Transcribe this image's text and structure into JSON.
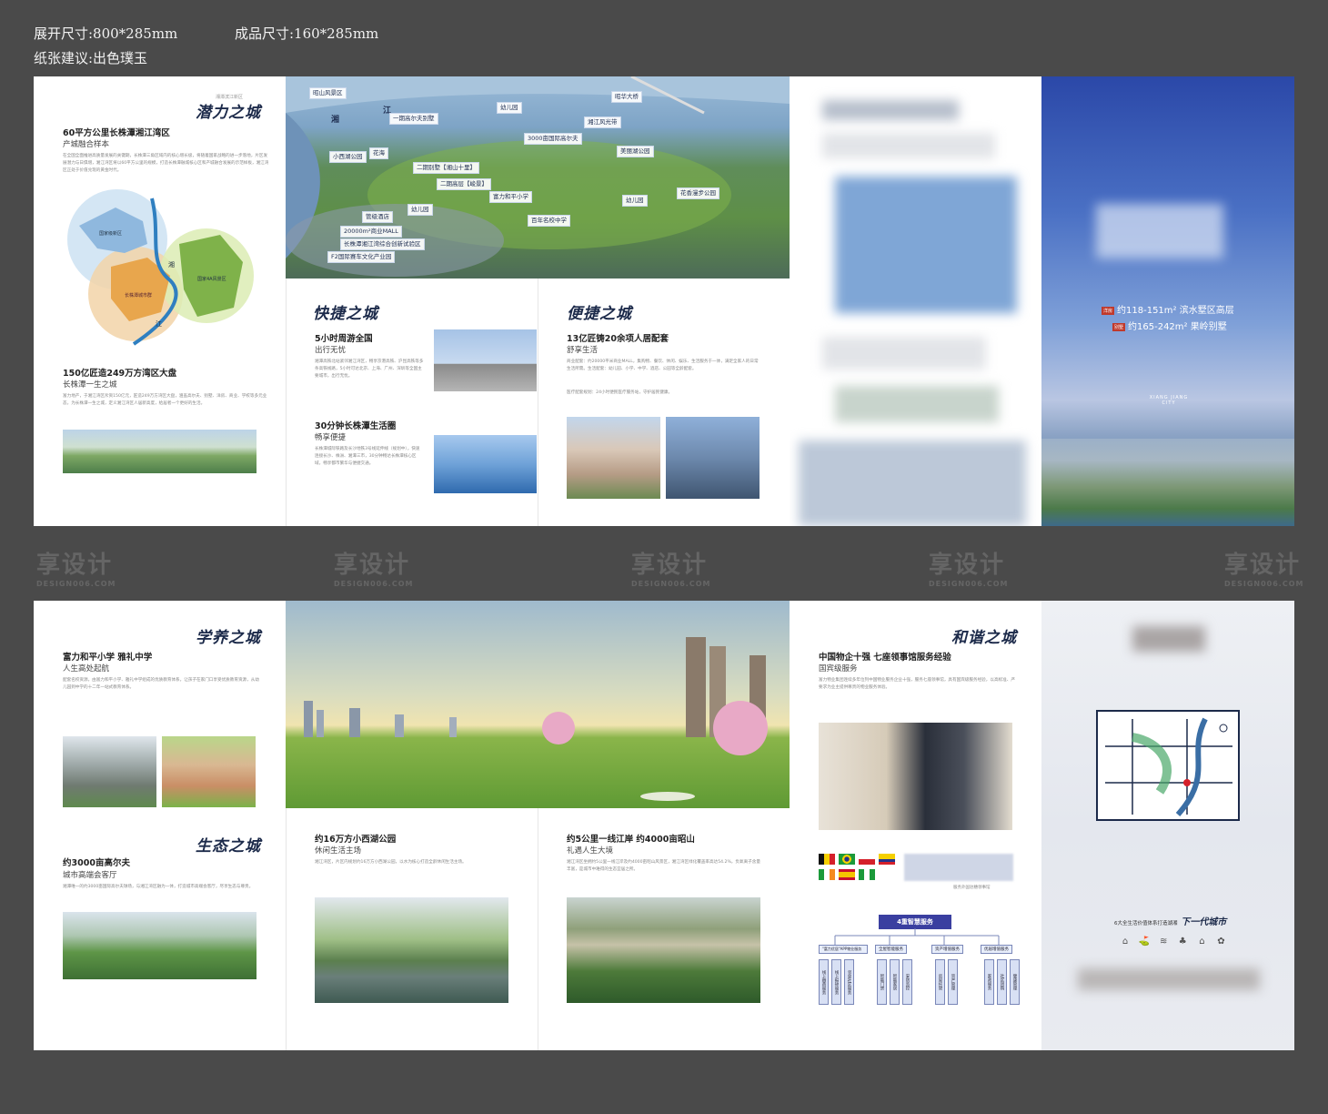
{
  "specs": {
    "expanded_size": "展开尺寸:800*285mm",
    "finished_size": "成品尺寸:160*285mm",
    "paper": "纸张建议:出色璞玉"
  },
  "watermark": {
    "text": "享设计",
    "sub": "DESIGN006.COM"
  },
  "top": {
    "p1": {
      "brand": "潜力之城",
      "brand_sup": "湘潭滨江新区",
      "title1": "60平方公里长株潭湘江湾区",
      "sub1": "产城融合样本",
      "body1": "在全国全面推进高质量发展的关键期，长株潭三角区域内的核心增长极，将随着国家战略的进一步落地，片区发展潜力与日俱增，湘江湾区将以60平方公里的规模，打造长株潭融城核心区和产城融合发展的示范样板，湘江湾区正处于价值兑现的黄金时代。",
      "map_labels": {
        "l1": "国家级新区",
        "l2": "湘",
        "l3": "长株潭城市群",
        "l4": "国家4A风景区",
        "l5": "江"
      },
      "title2": "150亿匠造249万方湾区大盘",
      "sub2": "长株潭一生之城",
      "body2": "富力地产，于湘江湾区斥资150亿元，匠造249万方湾区大盘，涵盖高尔夫、别墅、洋房、商业、学校等多元业态，为长株潭一生之城，定义湘江湾区人居新高度，给居者一个更好的生活。"
    },
    "aerial": {
      "labels": [
        "昭山风景区",
        "湘",
        "江",
        "一期高尔夫别墅",
        "幼儿园",
        "湘江风光带",
        "3000亩国际高尔夫",
        "花海",
        "小西湖公园",
        "二期别墅【湘山十里】",
        "美丽湖公园",
        "二期高层【峻景】",
        "富力和平小学",
        "幼儿园",
        "幼儿园",
        "花香漫步公园",
        "管级酒店",
        "百年名校中学",
        "20000m²商业MALL",
        "长株潭湘江湾综合创新试验区",
        "F2国际赛车文化产业园"
      ],
      "bridge": "昭华大桥"
    },
    "p2a": {
      "brand": "快捷之城",
      "title1": "5小时周游全国",
      "sub1": "出行无忧",
      "body1": "湘潭高铁北站紧邻湘江湾区，畅享京港高铁、沪昆高铁等多条高铁线路，5小时可达北京、上海、广州、深圳等全国主要城市，出行无忧。",
      "title2": "30分钟长株潭生活圈",
      "sub2": "畅享便捷",
      "body2": "长株潭城际铁路及长沙地铁3号线延伸线（规划中），快速连接长沙、株洲、湘潭三市，30分钟畅达长株潭核心区域，畅享都市繁华与便捷交通。"
    },
    "p2b": {
      "brand": "便捷之城",
      "title1": "13亿匠铸20余项人居配套",
      "sub1": "舒享生活",
      "body1": "商业配套：约20000平米商业MALL，集购物、餐饮、休闲、娱乐、生活服务于一体，满足全家人的日常生活所需。生活配套：幼儿园、小学、中学、酒店、公园等全龄配套。",
      "body2": "医疗配套规划：24小时便民医疗服务站，守护居民健康。"
    },
    "cover": {
      "line1_badge": "洋房",
      "line1": "约118-151m² 滨水墅区高层",
      "line2_badge": "别墅",
      "line2": "约165-242m² 果岭别墅",
      "logo": "XIANG JIANG CITY"
    }
  },
  "bottom": {
    "p1": {
      "brand": "学养之城",
      "title1": "富力和平小学 雅礼中学",
      "sub1": "人生高处起航",
      "body1": "配套名校资源，由富力和平小学、雅礼中学组成的优质教育体系，让孩子在家门口享受优质教育资源，从幼儿园到中学的十二年一站式教育体系。",
      "brand2": "生态之城",
      "title2": "约3000亩高尔夫",
      "sub2": "城市高端会客厅",
      "body2": "湘潭唯一的约3000亩国际高尔夫球场，与湘江湾区融为一体，打造城市高端会客厅，尽享生态与尊贵。"
    },
    "p2": {
      "title1": "约16万方小西湖公园",
      "sub1": "休闲生活主场",
      "body1": "湘江湾区，片区内规划约16万方小西湖公园，以水为核心打造全龄休闲生活主场。",
      "title2": "约5公里一线江岸 约4000亩昭山",
      "sub2": "礼遇人生大境",
      "body2": "湘江湾区坐拥约5公里一线江岸及约4000亩昭山风景区，湘江湾区绿化覆盖率高达54.2%，负氧离子含量丰富，是城市中难得的生态宜居之所。"
    },
    "p3": {
      "brand": "和谐之城",
      "title1": "中国物企十强 七座领事馆服务经验",
      "sub1": "国宾级服务",
      "body1": "富力物业集团连续多年位列中国物业服务企业十强，服务七座领事馆，具有国宾级服务经验，以高标准、严要求为业主提供尊贵的物业服务体验。",
      "flags_caption": "服务外国驻穗领事馆",
      "smart_title": "4重智慧服务",
      "smart_heads": [
        "\"富力优居\"APP物业服务",
        "全屋智能服务",
        "资产增值服务",
        "优居增值服务"
      ],
      "smart_items": [
        "线上缴费服务",
        "线上报修服务",
        "邻里社区服务",
        "智能门禁",
        "智能家居",
        "安防监控",
        "房屋托管",
        "资产管理",
        "家政服务",
        "社区团购",
        "健康管理"
      ]
    },
    "p4": {
      "tagline": "6大全生活价值体系打造湖湘",
      "tagline_brand": "下一代城市",
      "icons": [
        "⌂",
        "⛳",
        "≋",
        "♣",
        "⌂",
        "✿"
      ]
    }
  },
  "colors": {
    "brand_navy": "#1c2a4a",
    "sky": "#3b5bb0",
    "lawn": "#6aa33a",
    "page_bg": "#4a4a4a"
  }
}
